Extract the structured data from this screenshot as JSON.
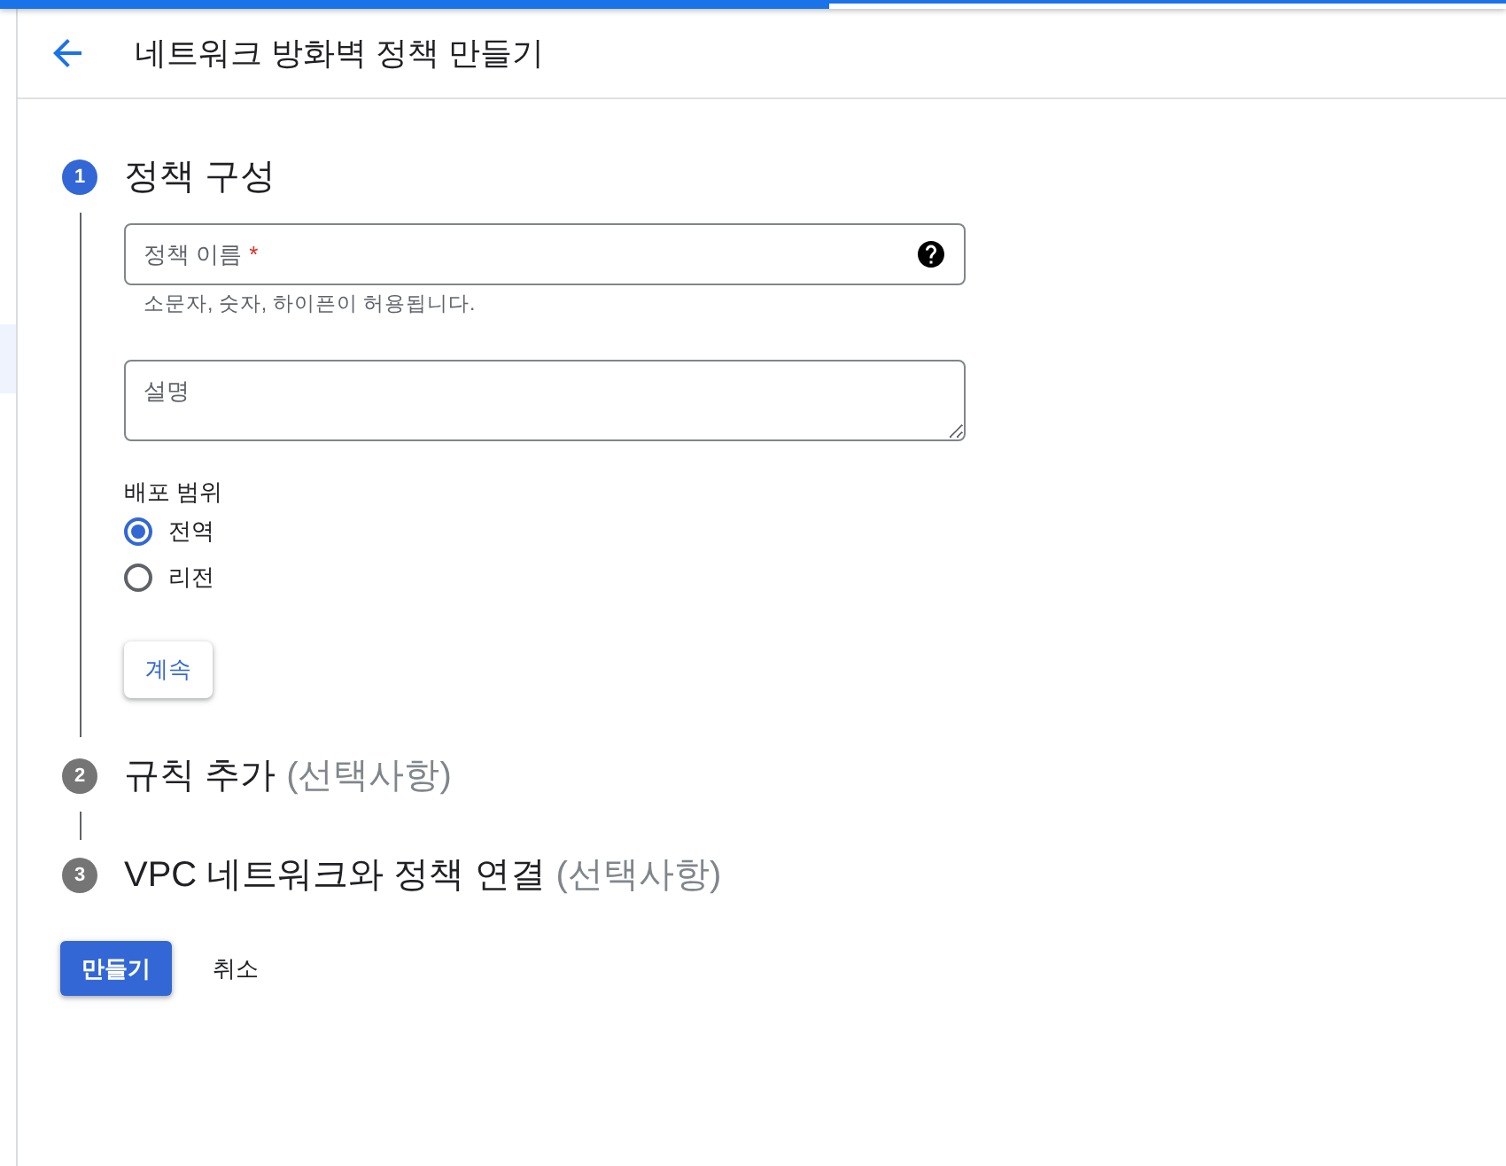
{
  "progress": {
    "level": 0.55
  },
  "sidebar": {
    "items": [
      {
        "selected": true
      }
    ]
  },
  "header": {
    "title": "네트워크 방화벽 정책 만들기"
  },
  "steps": [
    {
      "number": "1",
      "title": "정책 구성",
      "selected": true,
      "fields": [
        {
          "kind": "text",
          "label": "정책 이름",
          "required_mark": "*",
          "hint": "소문자, 숫자, 하이픈이 허용됩니다."
        },
        {
          "kind": "textarea",
          "placeholder": "설명"
        }
      ],
      "scope": {
        "label": "배포 범위",
        "options": [
          {
            "label": "전역",
            "selected": true
          },
          {
            "label": "리전",
            "selected": false
          }
        ]
      },
      "continue_button": "계속"
    },
    {
      "number": "2",
      "title": "규칙 추가",
      "note": "(선택사항)",
      "selected": false
    },
    {
      "number": "3",
      "title": "VPC 네트워크와 정책 연결",
      "note": "(선택사항)",
      "selected": false
    }
  ],
  "footer": {
    "buttons": [
      {
        "label": "만들기",
        "kind": "primary"
      },
      {
        "label": "취소",
        "kind": "text"
      }
    ]
  }
}
